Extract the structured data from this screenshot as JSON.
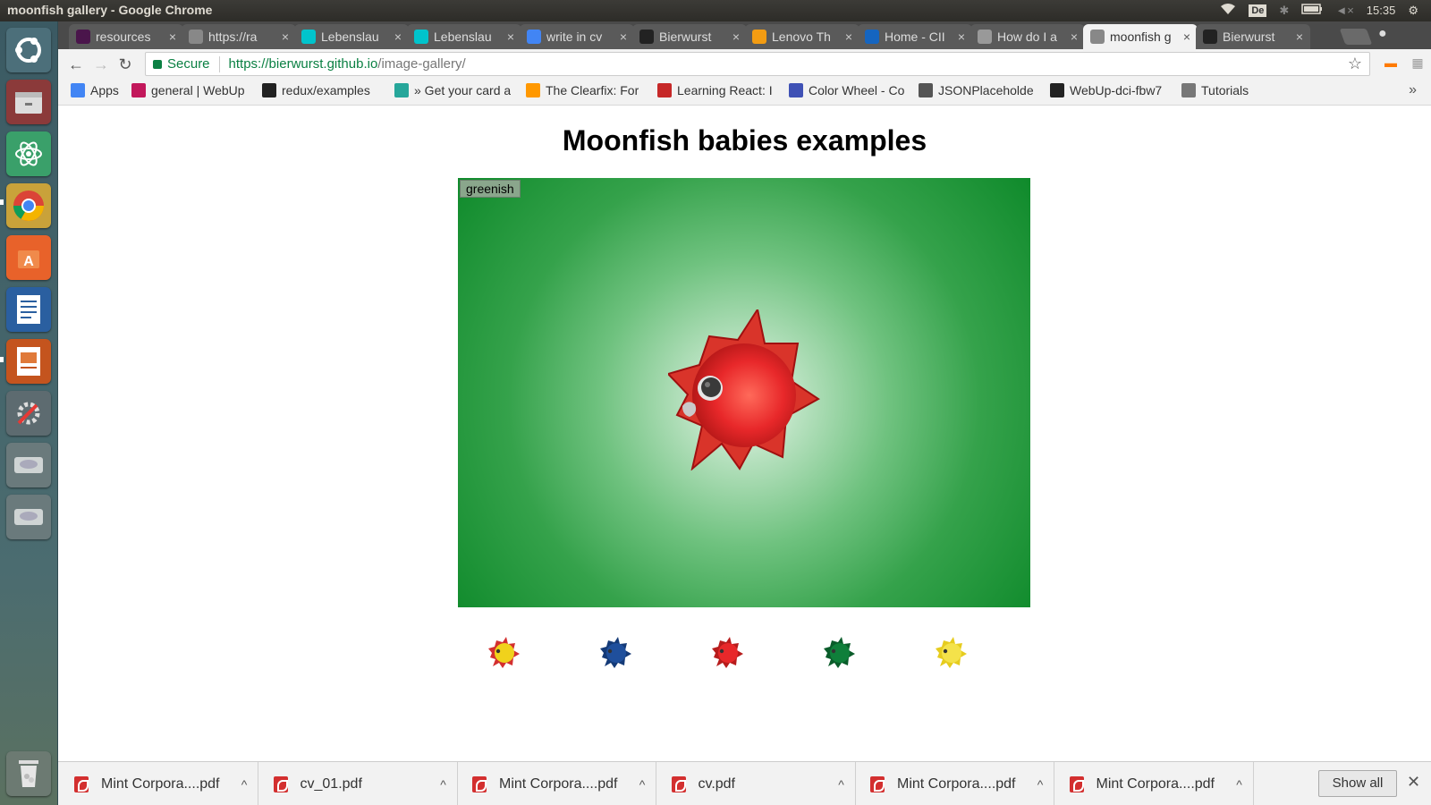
{
  "window": {
    "title": "moonfish gallery - Google Chrome"
  },
  "top_panel": {
    "keyboard_layout": "De",
    "time": "15:35"
  },
  "tabs": [
    {
      "label": "resources",
      "favicon": "slack-icon",
      "color": "#4a154b"
    },
    {
      "label": "https://ra",
      "favicon": "page-icon",
      "color": "#888888"
    },
    {
      "label": "Lebenslau",
      "favicon": "canva-icon",
      "color": "#00c4cc"
    },
    {
      "label": "Lebenslau",
      "favicon": "canva-icon",
      "color": "#00c4cc"
    },
    {
      "label": "write in cv",
      "favicon": "google-icon",
      "color": "#4285f4"
    },
    {
      "label": "Bierwurst",
      "favicon": "github-icon",
      "color": "#222222"
    },
    {
      "label": "Lenovo Th",
      "favicon": "lenovo-icon",
      "color": "#f39c12"
    },
    {
      "label": "Home - CII",
      "favicon": "c-icon",
      "color": "#1565c0"
    },
    {
      "label": "How do I a",
      "favicon": "loading-icon",
      "color": "#999999"
    },
    {
      "label": "moonfish g",
      "favicon": "page-icon",
      "color": "#888888",
      "active": true
    },
    {
      "label": "Bierwurst",
      "favicon": "github-icon",
      "color": "#222222"
    }
  ],
  "toolbar": {
    "secure_label": "Secure",
    "url_main": "https://bierwurst.github.io",
    "url_path": "/image-gallery/"
  },
  "bookmarks": [
    {
      "label": "Apps",
      "icon": "apps-grid-icon",
      "color": "#4285f4"
    },
    {
      "label": "general | WebUp",
      "icon": "slack-icon",
      "color": "#c2185b"
    },
    {
      "label": "redux/examples",
      "icon": "github-icon",
      "color": "#222222"
    },
    {
      "label": "» Get your card a",
      "icon": "globe-icon",
      "color": "#26a69a"
    },
    {
      "label": "The Clearfix: For",
      "icon": "asterisk-icon",
      "color": "#ff9800"
    },
    {
      "label": "Learning React: I",
      "icon": "react-dots-icon",
      "color": "#c62828"
    },
    {
      "label": "Color Wheel - Co",
      "icon": "color-wheel-icon",
      "color": "#3f51b5"
    },
    {
      "label": "JSONPlaceholde",
      "icon": "json-icon",
      "color": "#555555"
    },
    {
      "label": "WebUp-dci-fbw7",
      "icon": "github-icon",
      "color": "#222222"
    },
    {
      "label": "Tutorials",
      "icon": "folder-icon",
      "color": "#777777"
    }
  ],
  "page": {
    "title": "Moonfish babies examples",
    "image_label": "greenish",
    "main_fish_color": "#e8282a",
    "thumbnails": [
      {
        "color": "#f0d21c",
        "accent": "#d32f2f",
        "name": "yellow-red"
      },
      {
        "color": "#1f4f9c",
        "accent": "#143a77",
        "name": "blue"
      },
      {
        "color": "#e8282a",
        "accent": "#b71c1c",
        "name": "red"
      },
      {
        "color": "#0f7f3a",
        "accent": "#0a5c2a",
        "name": "green"
      },
      {
        "color": "#f4e24a",
        "accent": "#e6cc1e",
        "name": "yellow"
      }
    ]
  },
  "downloads": {
    "items": [
      "Mint Corpora....pdf",
      "cv_01.pdf",
      "Mint Corpora....pdf",
      "cv.pdf",
      "Mint Corpora....pdf",
      "Mint Corpora....pdf"
    ],
    "show_all": "Show all"
  }
}
